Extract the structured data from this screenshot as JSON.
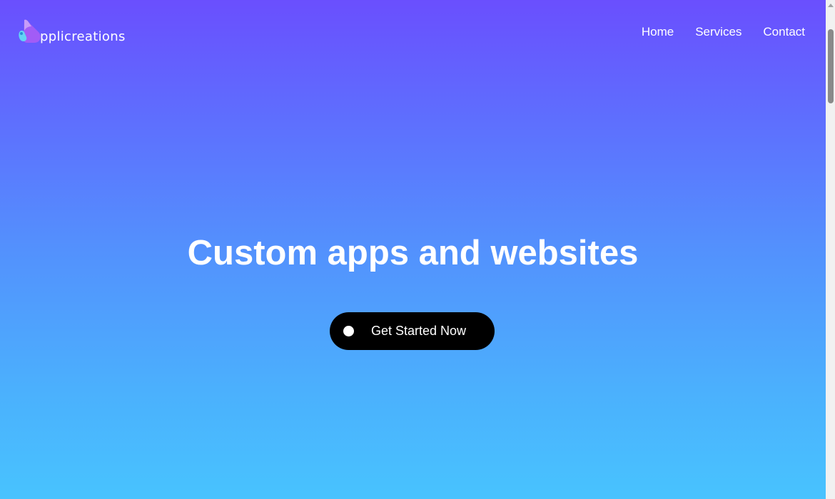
{
  "brand": {
    "logo_text": "pplicreations",
    "logo_icon": "applicreations-logo-icon",
    "colors": {
      "purple": "#a25cf6",
      "cyan": "#63d3f5"
    }
  },
  "nav": {
    "items": [
      {
        "label": "Home"
      },
      {
        "label": "Services"
      },
      {
        "label": "Contact"
      }
    ]
  },
  "hero": {
    "headline": "Custom apps and websites",
    "cta_label": "Get Started Now",
    "gradient": {
      "top": "#6a4ffe",
      "bottom": "#48c3fe"
    },
    "cta_background": "#000000"
  },
  "scrollbar": {
    "up_icon": "scroll-up-arrow-icon"
  }
}
